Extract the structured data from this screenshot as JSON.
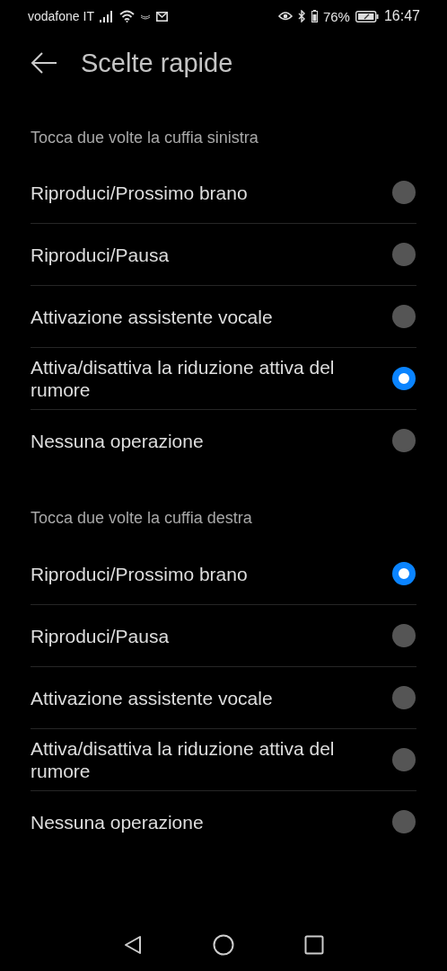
{
  "status_bar": {
    "carrier": "vodafone IT",
    "battery_percent": "76%",
    "time": "16:47"
  },
  "header": {
    "title": "Scelte rapide"
  },
  "sections": [
    {
      "title": "Tocca due volte la cuffia sinistra",
      "options": [
        {
          "label": "Riproduci/Prossimo brano",
          "selected": false
        },
        {
          "label": "Riproduci/Pausa",
          "selected": false
        },
        {
          "label": "Attivazione assistente vocale",
          "selected": false
        },
        {
          "label": "Attiva/disattiva la riduzione attiva del rumore",
          "selected": true
        },
        {
          "label": "Nessuna operazione",
          "selected": false
        }
      ]
    },
    {
      "title": "Tocca due volte la cuffia destra",
      "options": [
        {
          "label": "Riproduci/Prossimo brano",
          "selected": true
        },
        {
          "label": "Riproduci/Pausa",
          "selected": false
        },
        {
          "label": "Attivazione assistente vocale",
          "selected": false
        },
        {
          "label": "Attiva/disattiva la riduzione attiva del rumore",
          "selected": false
        },
        {
          "label": "Nessuna operazione",
          "selected": false
        }
      ]
    }
  ]
}
